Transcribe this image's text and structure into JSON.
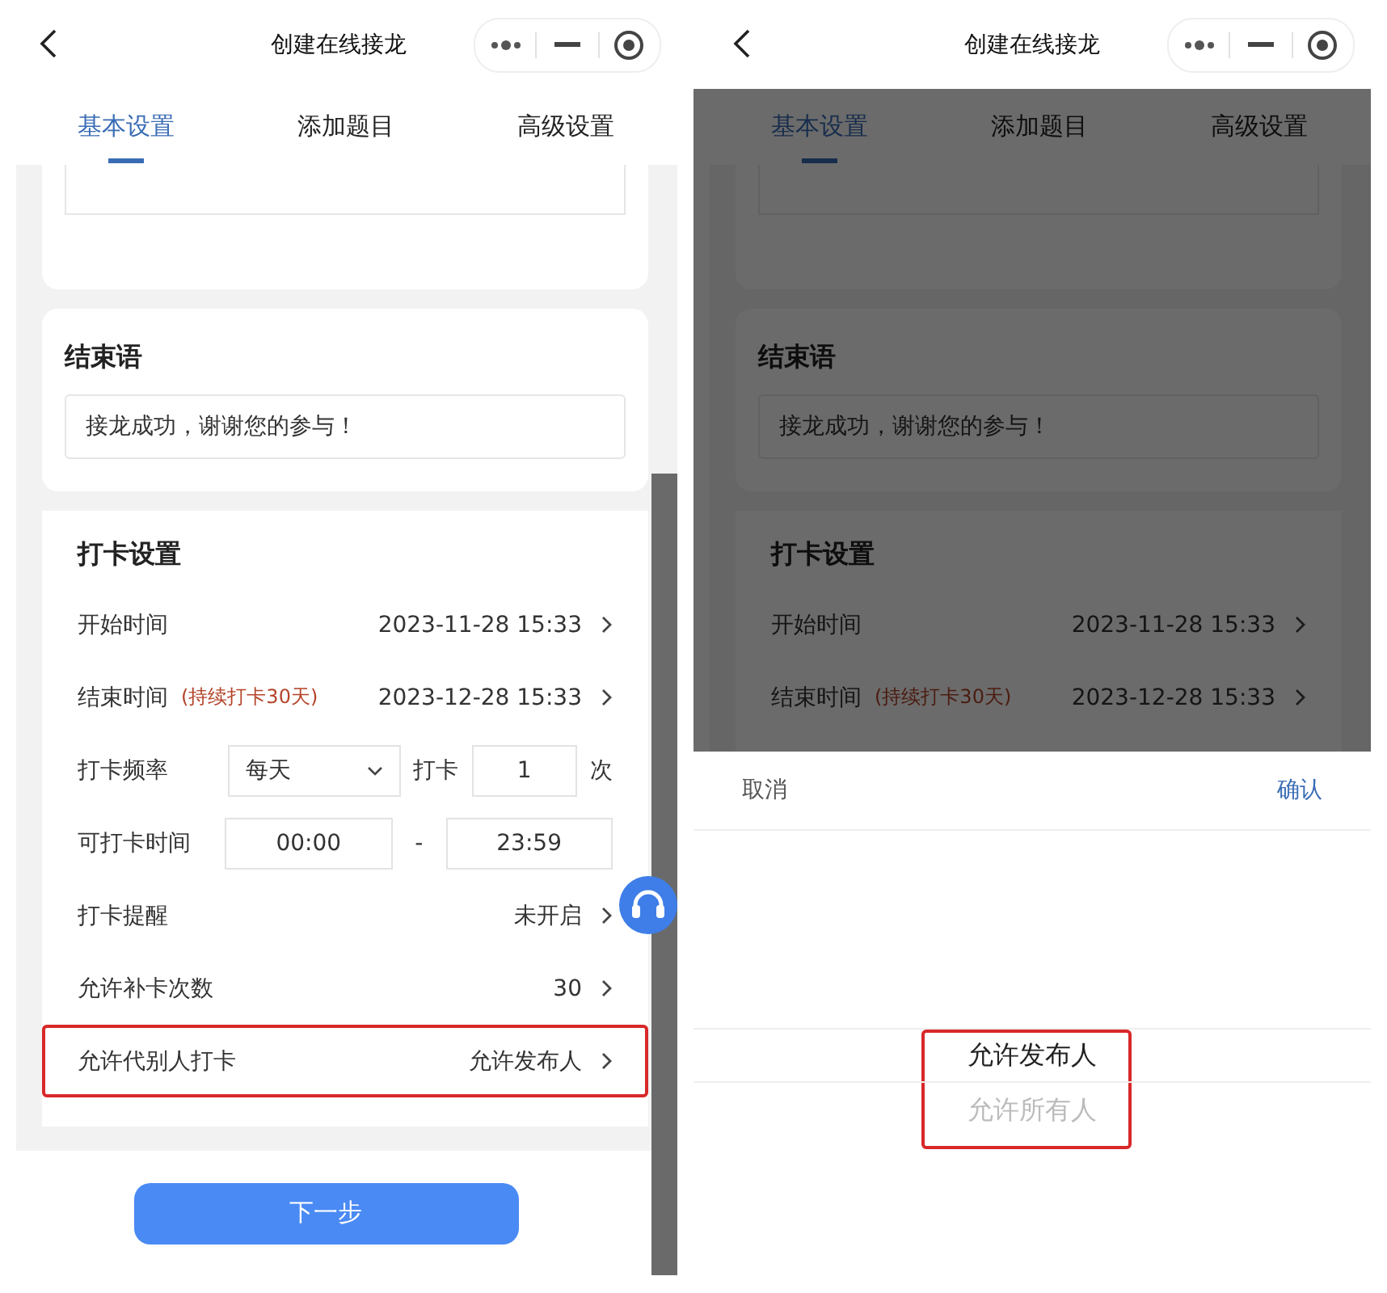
{
  "left_screen": {
    "header": {
      "title": "创建在线接龙"
    },
    "tabs": [
      {
        "label": "基本设置",
        "selected": true
      },
      {
        "label": "添加题目",
        "selected": false
      },
      {
        "label": "高级设置",
        "selected": false
      }
    ],
    "end_message": {
      "title": "结束语",
      "value": "接龙成功，谢谢您的参与！"
    },
    "checkin": {
      "title": "打卡设置",
      "rows": [
        {
          "kind": "link",
          "label": "开始时间",
          "value": "2023-11-28 15:33",
          "highlighted": false
        },
        {
          "kind": "link",
          "label": "结束时间",
          "note": "(持续打卡30天)",
          "value": "2023-12-28 15:33",
          "highlighted": false
        },
        {
          "kind": "frequency",
          "label": "打卡频率",
          "select": "每天",
          "mid": "打卡",
          "count": "1",
          "unit": "次",
          "highlighted": false
        },
        {
          "kind": "range",
          "label": "可打卡时间",
          "start": "00:00",
          "separator": "-",
          "end": "23:59",
          "highlighted": false
        },
        {
          "kind": "link",
          "label": "打卡提醒",
          "value": "未开启",
          "highlighted": false
        },
        {
          "kind": "link",
          "label": "允许补卡次数",
          "value": "30",
          "highlighted": false
        },
        {
          "kind": "link",
          "label": "允许代别人打卡",
          "value": "允许发布人",
          "highlighted": true
        }
      ]
    },
    "next_button": "下一步"
  },
  "right_screen": {
    "header": {
      "title": "创建在线接龙"
    },
    "tabs": [
      {
        "label": "基本设置",
        "selected": true
      },
      {
        "label": "添加题目",
        "selected": false
      },
      {
        "label": "高级设置",
        "selected": false
      }
    ],
    "end_message": {
      "title": "结束语",
      "value": "接龙成功，谢谢您的参与！"
    },
    "checkin": {
      "title": "打卡设置",
      "rows": [
        {
          "kind": "link",
          "label": "开始时间",
          "value": "2023-11-28 15:33",
          "highlighted": false
        },
        {
          "kind": "link",
          "label": "结束时间",
          "note": "(持续打卡30天)",
          "value": "2023-12-28 15:33",
          "highlighted": false
        }
      ]
    },
    "picker": {
      "cancel": "取消",
      "confirm": "确认",
      "highlighted": true,
      "options": [
        {
          "label": "允许发布人",
          "selected": true
        },
        {
          "label": "允许所有人",
          "selected": false
        }
      ]
    }
  }
}
